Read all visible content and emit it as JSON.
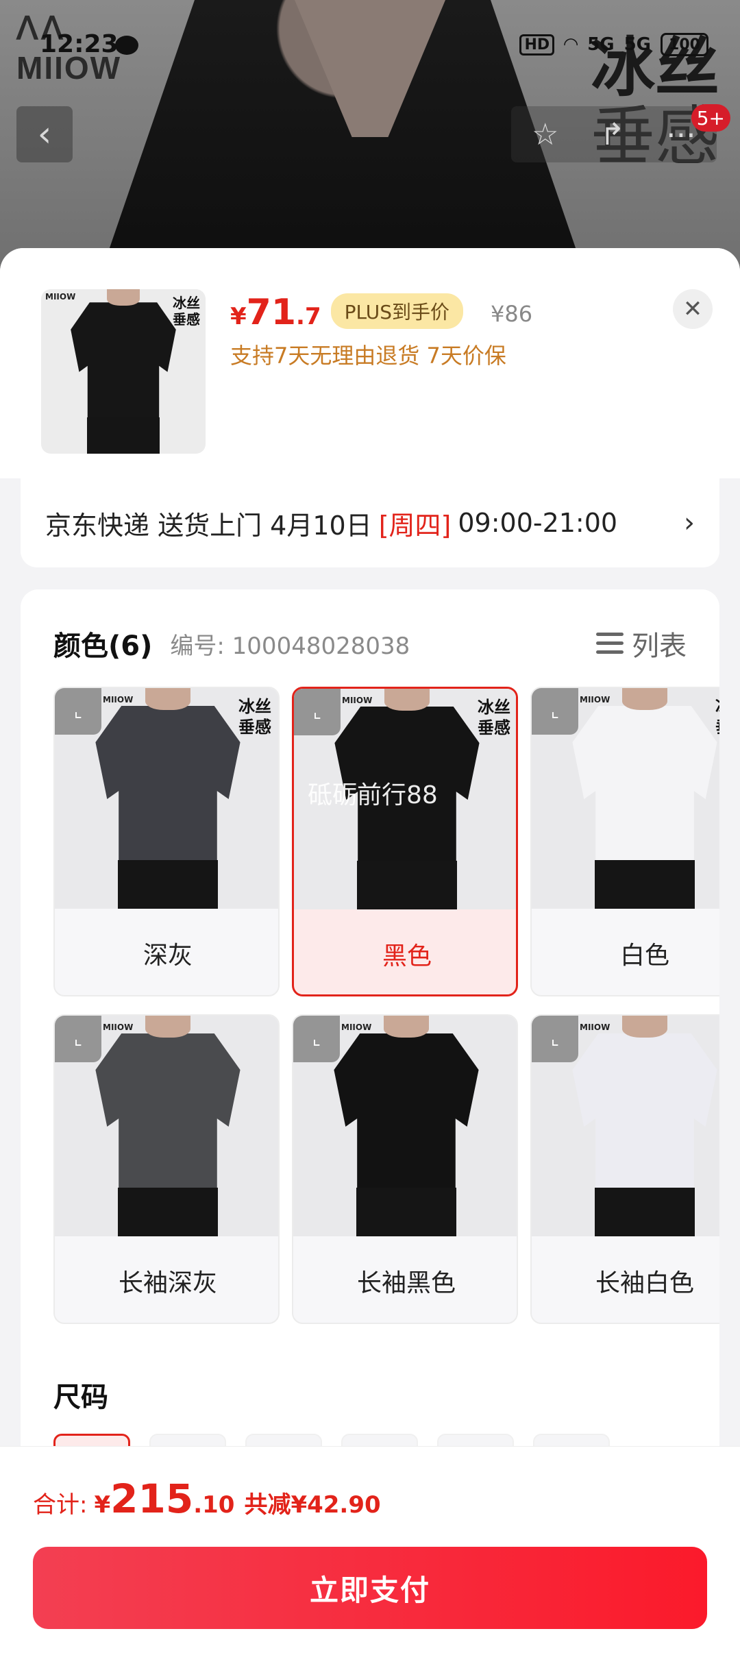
{
  "status_bar": {
    "time": "12:23",
    "signal_labels": [
      "HD",
      "5G",
      "5G"
    ],
    "battery": "100"
  },
  "background_page": {
    "brand_logo": "MIIOW",
    "promo_line1": "冰丝",
    "promo_line2": "垂感",
    "cart_badge": "5+"
  },
  "sku_header": {
    "price_symbol": "¥",
    "price_int": "71",
    "price_dec": ".7",
    "plus_tag": "PLUS到手价",
    "original_price": "¥86",
    "guarantee": "支持7天无理由退货  7天价保",
    "thumb_logo": "MIIOW",
    "thumb_promo1": "冰丝",
    "thumb_promo2": "垂感"
  },
  "delivery": {
    "text_prefix": "京东快递 送货上门 4月10日",
    "weekday": "[周四]",
    "time_window": "09:00-21:00",
    "arrow": "›"
  },
  "spec": {
    "title": "颜色(6)",
    "code": "编号: 100048028038",
    "list_toggle": "列表",
    "watermark": "砥砺前行88",
    "colors": [
      {
        "label": "深灰",
        "shirt_color": "#3e3f45",
        "selected": false,
        "promo1": "冰丝",
        "promo2": "垂感",
        "logo": "MIIOW"
      },
      {
        "label": "黑色",
        "shirt_color": "#141414",
        "selected": true,
        "promo1": "冰丝",
        "promo2": "垂感",
        "logo": "MIIOW"
      },
      {
        "label": "白色",
        "shirt_color": "#f4f4f6",
        "selected": false,
        "promo1": "冰丝",
        "promo2": "垂感",
        "logo": "MIIOW"
      },
      {
        "label": "长袖深灰",
        "shirt_color": "#4a4b4e",
        "selected": false,
        "promo1": "",
        "promo2": "",
        "logo": "MIIOW"
      },
      {
        "label": "长袖黑色",
        "shirt_color": "#121212",
        "selected": false,
        "promo1": "",
        "promo2": "",
        "logo": "MIIOW"
      },
      {
        "label": "长袖白色",
        "shirt_color": "#ececf2",
        "selected": false,
        "promo1": "",
        "promo2": "",
        "logo": "MIIOW"
      }
    ],
    "size_title": "尺码"
  },
  "bottom_bar": {
    "total_label": "合计:",
    "total_yen": "¥",
    "total_int": "215",
    "total_dec": ".10",
    "saved": "共减¥42.90",
    "pay_button": "立即支付"
  },
  "colors": {
    "accent": "#e2231a",
    "guarantee": "#c87b24",
    "plus_tag_bg": "#fbe7a4"
  }
}
